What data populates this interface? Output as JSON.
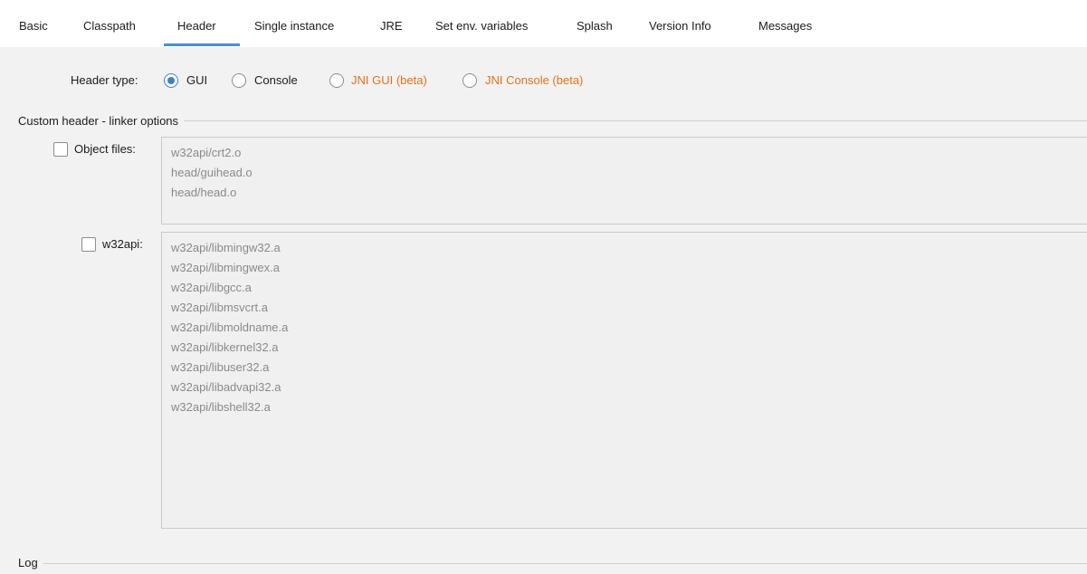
{
  "tabs": [
    {
      "label": "Basic"
    },
    {
      "label": "Classpath"
    },
    {
      "label": "Header"
    },
    {
      "label": "Single instance"
    },
    {
      "label": "JRE"
    },
    {
      "label": "Set env. variables"
    },
    {
      "label": "Splash"
    },
    {
      "label": "Version Info"
    },
    {
      "label": "Messages"
    }
  ],
  "active_tab": "Header",
  "header_type": {
    "label": "Header type:",
    "options": [
      {
        "label": "GUI",
        "checked": true
      },
      {
        "label": "Console",
        "checked": false
      },
      {
        "label": "JNI GUI (beta)",
        "checked": false
      },
      {
        "label": "JNI Console (beta)",
        "checked": false
      }
    ]
  },
  "custom_header": {
    "title": "Custom header - linker options",
    "object_files": {
      "label": "Object files:",
      "checked": false,
      "lines": [
        "w32api/crt2.o",
        "head/guihead.o",
        "head/head.o"
      ]
    },
    "w32api": {
      "label": "w32api:",
      "checked": false,
      "lines": [
        "w32api/libmingw32.a",
        "w32api/libmingwex.a",
        "w32api/libgcc.a",
        "w32api/libmsvcrt.a",
        "w32api/libmoldname.a",
        "w32api/libkernel32.a",
        "w32api/libuser32.a",
        "w32api/libadvapi32.a",
        "w32api/libshell32.a"
      ]
    }
  },
  "log": {
    "title": "Log"
  },
  "colors": {
    "accent": "#3f7fcf",
    "beta_label": "#e8701a",
    "disabled_text": "#8a8a8a"
  }
}
